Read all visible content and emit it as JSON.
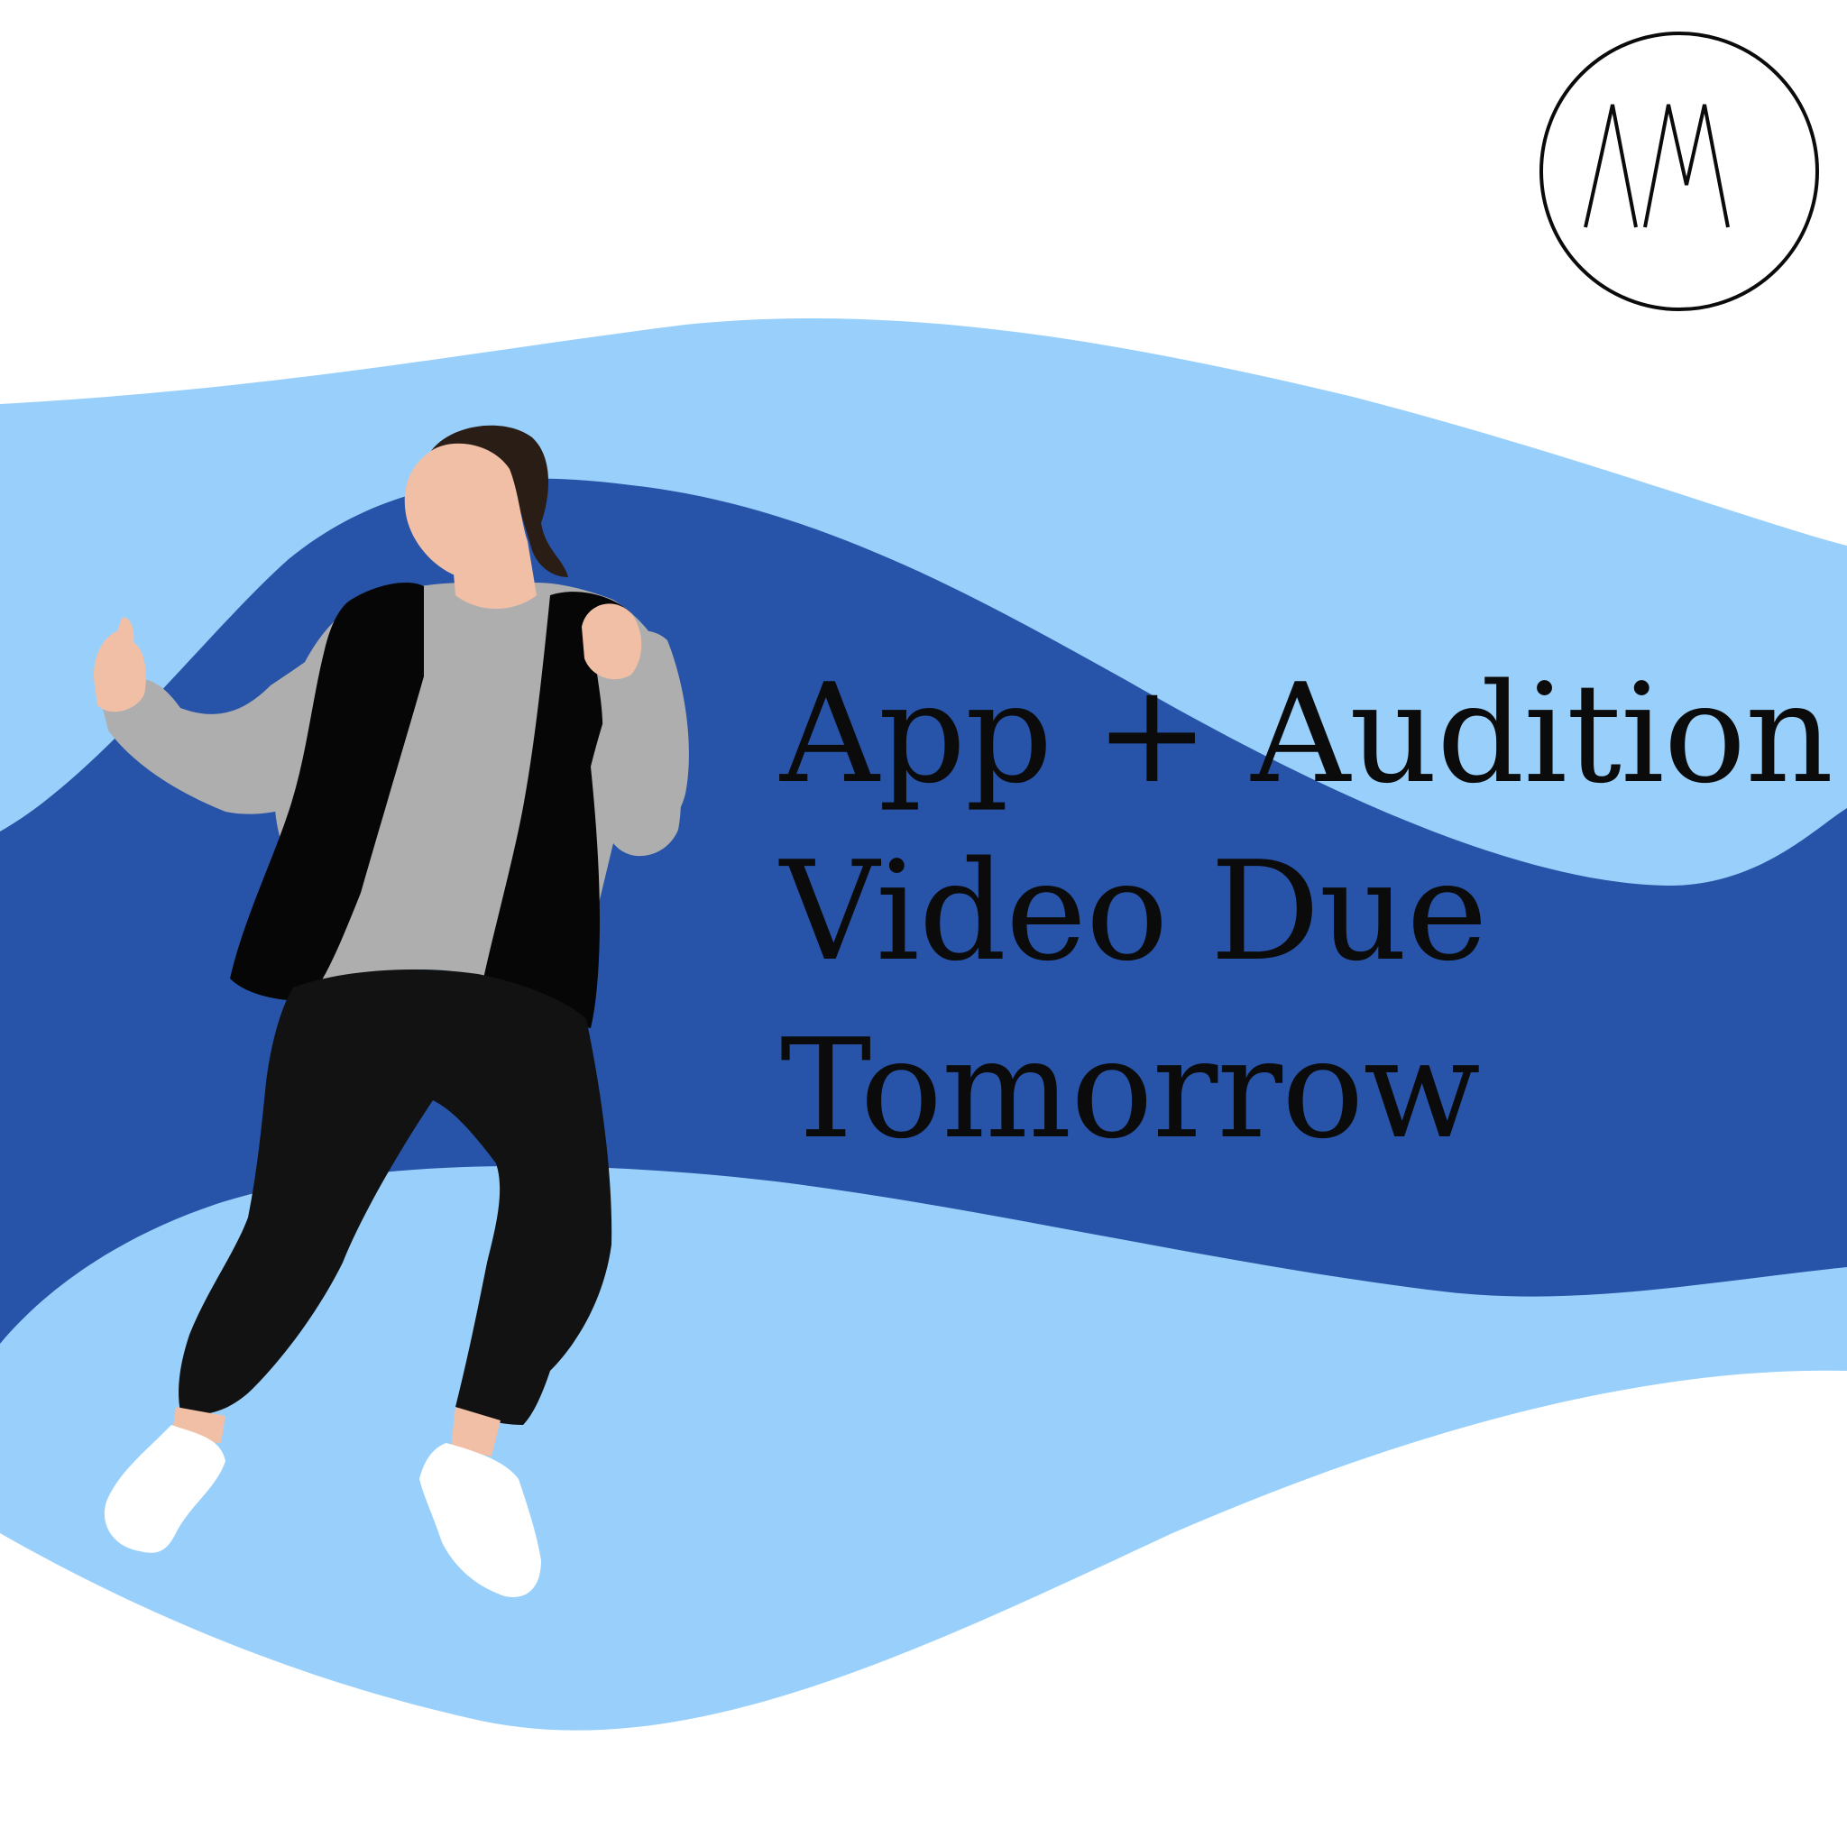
{
  "headline": {
    "line1": "App + Audition",
    "line2": "Video Due",
    "line3": "Tomorrow"
  },
  "logo": {
    "text": "AM",
    "icon": "am-monogram-circle-logo"
  },
  "illustration": {
    "icon": "dancing-person-illustration"
  },
  "colors": {
    "background": "#ffffff",
    "wave_light": "#98d0fb",
    "wave_dark": "#2754a8",
    "text": "#0b0b0b",
    "hoodie": "#aeaeae",
    "vest": "#060606",
    "pants": "#121212",
    "skin": "#f0bfa6",
    "hair": "#2a1d16",
    "shoes": "#ffffff"
  }
}
